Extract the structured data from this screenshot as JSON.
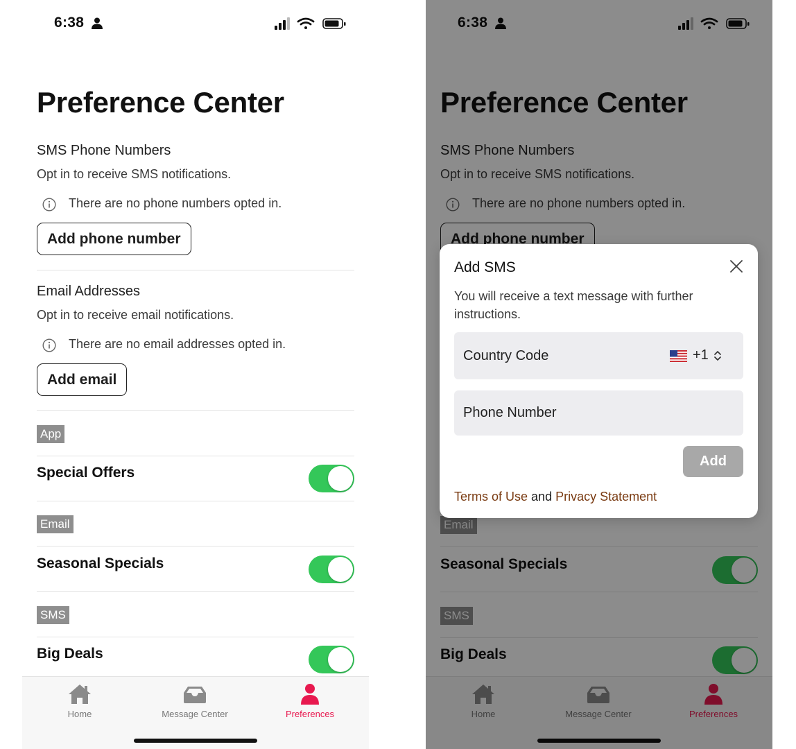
{
  "status_bar": {
    "time": "6:38"
  },
  "page": {
    "title": "Preference Center"
  },
  "sms_section": {
    "title": "SMS Phone Numbers",
    "subtitle": "Opt in to receive SMS notifications.",
    "empty_text": "There are no phone numbers opted in.",
    "button_label": "Add phone number"
  },
  "email_section": {
    "title": "Email Addresses",
    "subtitle": "Opt in to receive email notifications.",
    "empty_text": "There are no email addresses opted in.",
    "button_label": "Add email"
  },
  "categories": {
    "app": {
      "label": "App",
      "preference": "Special Offers",
      "enabled": true
    },
    "email": {
      "label": "Email",
      "preference": "Seasonal Specials",
      "enabled": true
    },
    "sms": {
      "label": "SMS",
      "preference": "Big Deals",
      "enabled": true
    }
  },
  "tabs": [
    {
      "label": "Home",
      "icon": "house-icon",
      "active": false
    },
    {
      "label": "Message Center",
      "icon": "inbox-tray-icon",
      "active": false
    },
    {
      "label": "Preferences",
      "icon": "person-icon",
      "active": true
    }
  ],
  "modal": {
    "title": "Add SMS",
    "description": "You will receive a text message with further instructions.",
    "country_code_label": "Country Code",
    "country_code_value": "+1",
    "country_flag_icon": "us-flag-icon",
    "phone_placeholder": "Phone Number",
    "add_label": "Add",
    "terms_link": "Terms of Use",
    "legal_connector": "and",
    "privacy_link": "Privacy Statement"
  },
  "colors": {
    "toggle_on": "#34c759",
    "accent_active_tab": "#e8194f",
    "badge_bg": "#8e8e8e",
    "legal_link": "#7a3b12",
    "add_button_disabled": "#a8a8a8"
  }
}
